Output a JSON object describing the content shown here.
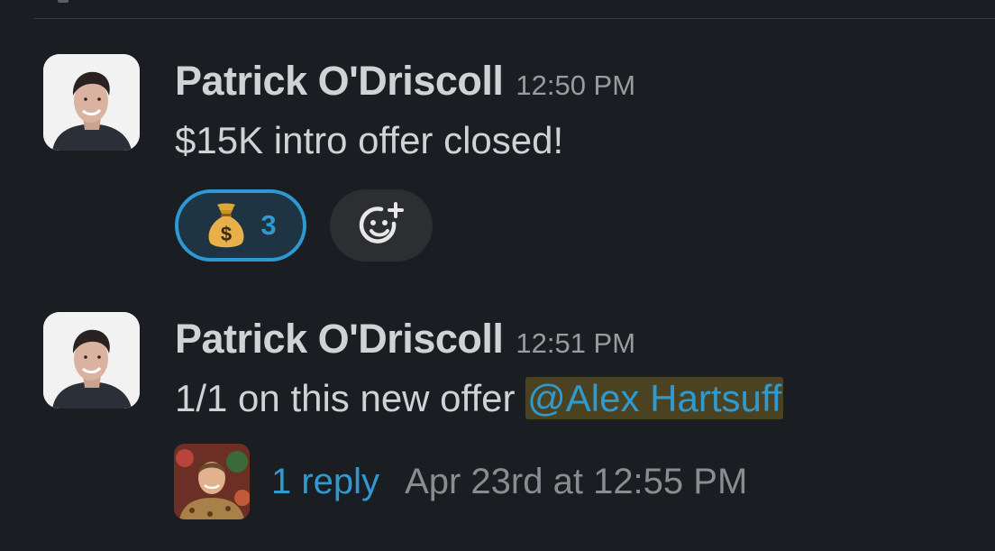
{
  "messages": [
    {
      "sender": "Patrick O'Driscoll",
      "time": "12:50 PM",
      "text": "$15K intro offer closed!",
      "reactions": [
        {
          "emoji": "money-bag",
          "count": "3",
          "selected": true
        }
      ],
      "avatar_icon": "profile-photo"
    },
    {
      "sender": "Patrick O'Driscoll",
      "time": "12:51 PM",
      "text_prefix": "1/1 on this new offer ",
      "mention": "@Alex Hartsuff",
      "thread": {
        "reply_label": "1 reply",
        "last_reply_time": "Apr 23rd at 12:55 PM"
      },
      "avatar_icon": "profile-photo"
    }
  ],
  "icons": {
    "add_reaction": "add-reaction-icon",
    "reaction_emoji": "money-bag-icon"
  },
  "colors": {
    "background": "#1a1d21",
    "text": "#d1d2d3",
    "muted": "#9a9b9d",
    "link": "#2e9ad0",
    "reaction_border": "#2d98d2",
    "mention_bg": "#4a4221"
  }
}
